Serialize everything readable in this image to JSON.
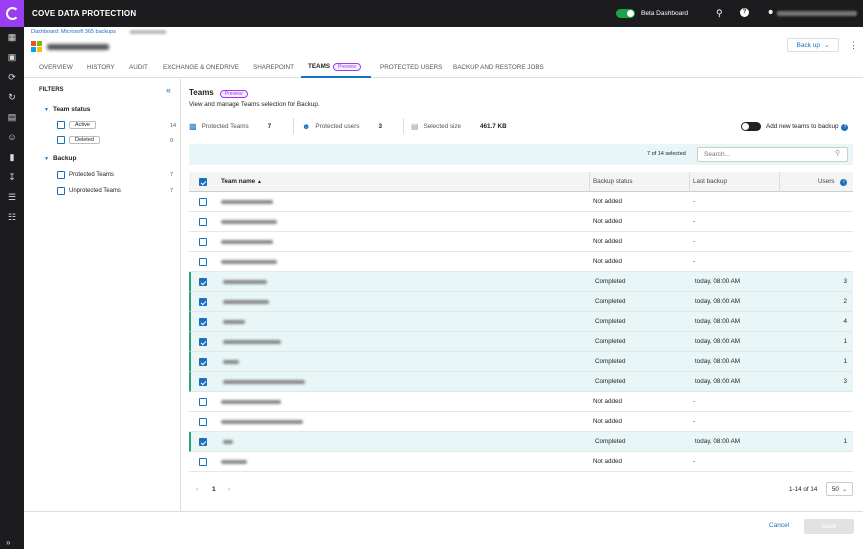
{
  "app": {
    "title": "COVE DATA PROTECTION",
    "beta_label": "Beta Dashboard"
  },
  "icons": {
    "search": "search-icon",
    "help": "help-icon",
    "user": "user-icon"
  },
  "breadcrumb": {
    "text": "Dashboard: Microsoft 365 backups"
  },
  "header": {
    "backup_button": "Back up"
  },
  "tabs": [
    {
      "label": "OVERVIEW"
    },
    {
      "label": "HISTORY"
    },
    {
      "label": "AUDIT"
    },
    {
      "label": "EXCHANGE & ONEDRIVE"
    },
    {
      "label": "SHAREPOINT"
    },
    {
      "label": "TEAMS",
      "badge": "Preview"
    },
    {
      "label": "PROTECTED USERS"
    },
    {
      "label": "BACKUP AND RESTORE JOBS"
    }
  ],
  "filters": {
    "title": "FILTERS",
    "team_status": {
      "label": "Team status",
      "items": [
        {
          "label": "Active",
          "count": "14"
        },
        {
          "label": "Deleted",
          "count": "0"
        }
      ]
    },
    "backup": {
      "label": "Backup",
      "items": [
        {
          "label": "Protected Teams",
          "count": "7"
        },
        {
          "label": "Unprotected Teams",
          "count": "7"
        }
      ]
    }
  },
  "main": {
    "title": "Teams",
    "badge": "Preview",
    "description": "View and manage Teams selection for Backup.",
    "stats": {
      "protected_teams_label": "Protected Teams",
      "protected_teams_value": "7",
      "protected_users_label": "Protected users",
      "protected_users_value": "3",
      "selected_size_label": "Selected size",
      "selected_size_value": "461.7 KB"
    },
    "add_new_label": "Add new teams to backup",
    "selected_count": "7 of 14 selected",
    "search_placeholder": "Search..."
  },
  "table": {
    "headers": {
      "name": "Team name",
      "status": "Backup status",
      "last": "Last backup",
      "users": "Users"
    },
    "rows": [
      {
        "selected": false,
        "status": "Not added",
        "last": "-",
        "users": ""
      },
      {
        "selected": false,
        "status": "Not added",
        "last": "-",
        "users": ""
      },
      {
        "selected": false,
        "status": "Not added",
        "last": "-",
        "users": ""
      },
      {
        "selected": false,
        "status": "Not added",
        "last": "-",
        "users": ""
      },
      {
        "selected": true,
        "status": "Completed",
        "last": "today, 08:00 AM",
        "users": "3"
      },
      {
        "selected": true,
        "status": "Completed",
        "last": "today, 08:00 AM",
        "users": "2"
      },
      {
        "selected": true,
        "status": "Completed",
        "last": "today, 08:00 AM",
        "users": "4"
      },
      {
        "selected": true,
        "status": "Completed",
        "last": "today, 08:00 AM",
        "users": "1"
      },
      {
        "selected": true,
        "status": "Completed",
        "last": "today, 08:00 AM",
        "users": "1"
      },
      {
        "selected": true,
        "status": "Completed",
        "last": "today, 08:00 AM",
        "users": "3"
      },
      {
        "selected": false,
        "status": "Not added",
        "last": "-",
        "users": ""
      },
      {
        "selected": false,
        "status": "Not added",
        "last": "-",
        "users": ""
      },
      {
        "selected": true,
        "status": "Completed",
        "last": "today, 08:00 AM",
        "users": "1"
      },
      {
        "selected": false,
        "status": "Not added",
        "last": "-",
        "users": ""
      }
    ]
  },
  "pagination": {
    "current": "1",
    "range": "1-14 of 14",
    "per_page": "50"
  },
  "footer": {
    "cancel": "Cancel",
    "save": "Save"
  }
}
